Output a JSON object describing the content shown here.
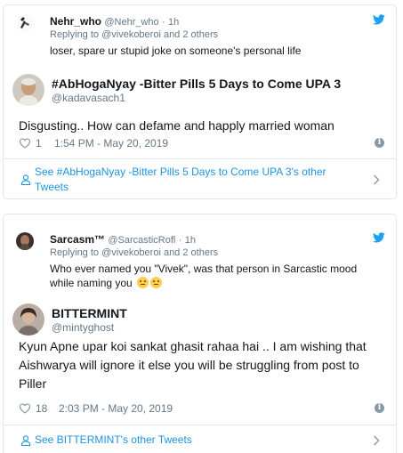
{
  "tweets": [
    {
      "embedded": {
        "name": "Nehr_who",
        "handle": "@Nehr_who",
        "separator": "·",
        "ago": "1h",
        "replying_to": "Replying to @vivekoberoi and 2 others",
        "text": "loser, spare ur stupid joke on someone's personal life"
      },
      "author": {
        "name": "#AbHogaNyay -Bitter Pills 5 Days to Come UPA 3",
        "handle": "@kadavasach1"
      },
      "text": "Disgusting.. How can  defame and happly married woman",
      "likes": "1",
      "timestamp": "1:54 PM - May 20, 2019",
      "see_more_line1": "See #AbHogaNyay -Bitter Pills 5 Days to Come UPA 3's other",
      "see_more_line2": "Tweets"
    },
    {
      "embedded": {
        "name": "Sarcasm™",
        "handle": "@SarcasticRofl",
        "separator": "·",
        "ago": "1h",
        "replying_to": "Replying to @vivekoberoi and 2 others",
        "text_line1": "Who ever named you \"Vivek\", was that person in Sarcastic mood",
        "text_line2": "while naming you"
      },
      "author": {
        "name": "BITTERMINT",
        "handle": "@mintyghost"
      },
      "text_line1": "Kyun Apne upar koi sankat ghasit rahaa hai .. I am wishing that",
      "text_line2": "Aishwarya will ignore it else you will be struggling from post to",
      "text_line3": "Piller",
      "likes": "18",
      "timestamp": "2:03 PM - May 20, 2019",
      "see_more_line1": "See BITTERMINT's other Tweets"
    }
  ],
  "colors": {
    "link": "#1c94e0",
    "twitter_blue": "#1da1f2",
    "meta_gray": "#657786",
    "border": "#e1e8ed"
  },
  "icons": [
    "twitter-bird-icon",
    "heart-icon",
    "info-icon",
    "person-icon",
    "chevron-right-icon",
    "thinking-face-emoji"
  ]
}
